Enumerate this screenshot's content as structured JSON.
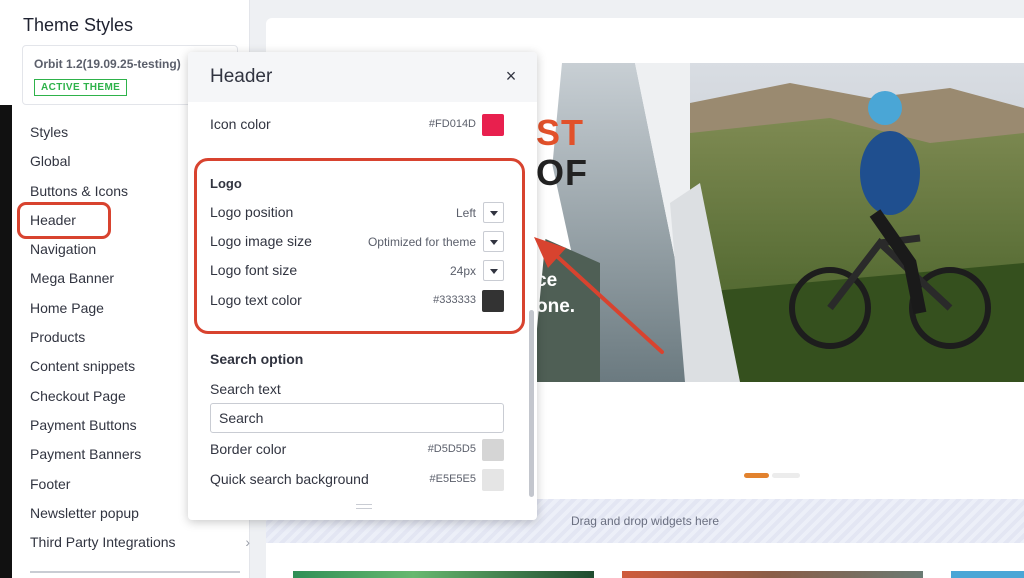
{
  "sidebar": {
    "title": "Theme Styles",
    "theme_card": {
      "name": "Orbit 1.2(19.09.25-testing)",
      "badge": "ACTIVE THEME"
    },
    "items": [
      {
        "label": "Styles"
      },
      {
        "label": "Global"
      },
      {
        "label": "Buttons & Icons"
      },
      {
        "label": "Header"
      },
      {
        "label": "Navigation"
      },
      {
        "label": "Mega Banner"
      },
      {
        "label": "Home Page"
      },
      {
        "label": "Products"
      },
      {
        "label": "Content snippets"
      },
      {
        "label": "Checkout Page"
      },
      {
        "label": "Payment Buttons"
      },
      {
        "label": "Payment Banners"
      },
      {
        "label": "Footer"
      },
      {
        "label": "Newsletter popup"
      },
      {
        "label": "Third Party Integrations",
        "chevron": "›"
      }
    ]
  },
  "panel": {
    "title": "Header",
    "close_icon": "×",
    "icon_color": {
      "label": "Icon color",
      "value": "#FD014D",
      "color": "#e8204e"
    },
    "logo_section": {
      "title": "Logo",
      "position": {
        "label": "Logo position",
        "value": "Left"
      },
      "image_size": {
        "label": "Logo image size",
        "value": "Optimized for theme"
      },
      "font_size": {
        "label": "Logo font size",
        "value": "24px"
      },
      "text_color": {
        "label": "Logo text color",
        "value": "#333333",
        "color": "#333333"
      }
    },
    "search_section": {
      "title": "Search option",
      "search_text_label": "Search text",
      "search_text_value": "Search",
      "border_color": {
        "label": "Border color",
        "value": "#D5D5D5",
        "color": "#D5D5D5"
      },
      "quick_bg": {
        "label": "Quick search background",
        "value": "#E5E5E5",
        "color": "#E5E5E5"
      }
    }
  },
  "preview": {
    "hero_line1": "ST",
    "hero_line2": "OF",
    "hero_line3": "ce",
    "hero_line4": "one.",
    "drop_zone_text": "Drag and drop widgets here"
  },
  "colors": {
    "annotation": "#d8432f",
    "active_badge": "#2eb24a",
    "slide_dot_active": "#e2822e"
  }
}
